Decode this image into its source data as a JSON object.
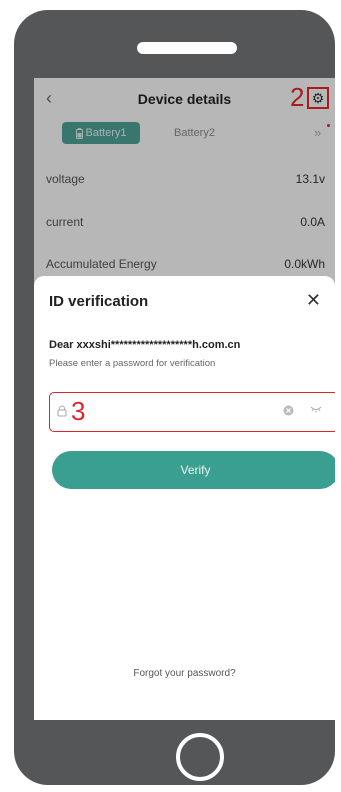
{
  "header": {
    "back_icon": "‹",
    "title": "Device details",
    "step_marker": "2"
  },
  "tabs": {
    "active": "Battery1",
    "inactive": "Battery2",
    "more": "»"
  },
  "rows": [
    {
      "label": "voltage",
      "value": "13.1v"
    },
    {
      "label": "current",
      "value": "0.0A"
    },
    {
      "label": "Accumulated Energy",
      "value": "0.0kWh"
    }
  ],
  "dialog": {
    "title": "ID verification",
    "close": "✕",
    "greeting": "Dear xxxshi*******************h.com.cn",
    "instruction": "Please enter a password for verification",
    "password_placeholder": "",
    "step_marker": "3",
    "verify_label": "Verify",
    "forgot_label": "Forgot your password?"
  },
  "colors": {
    "accent": "#3a9e90",
    "highlight": "#e0252a",
    "frame": "#555657"
  }
}
